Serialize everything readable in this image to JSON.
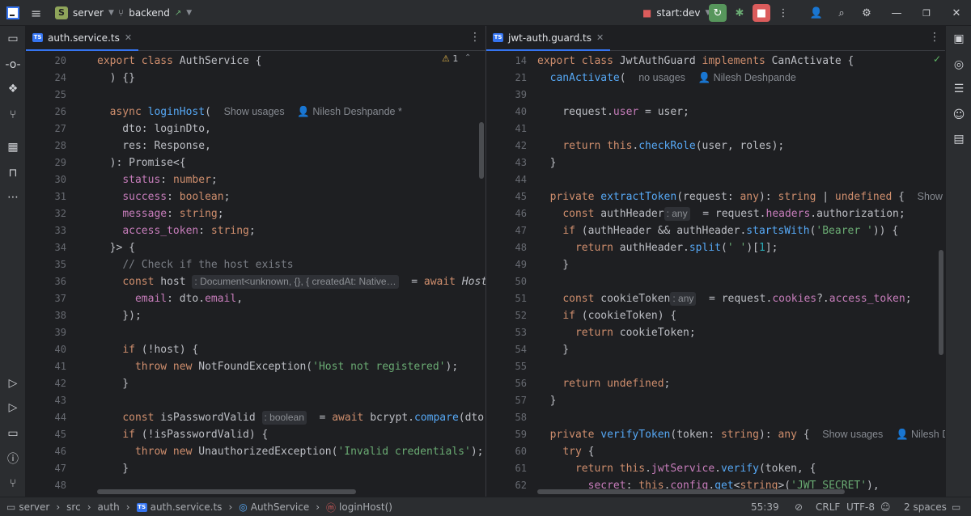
{
  "titlebar": {
    "project_badge": "S",
    "project": "server",
    "branch": "backend",
    "run_config": "start:dev"
  },
  "left_tab": {
    "label": "auth.service.ts",
    "badge": "TS"
  },
  "right_tab": {
    "label": "jwt-auth.guard.ts",
    "badge": "TS"
  },
  "left_editor": {
    "warning_count": "1",
    "line_numbers": [
      "20",
      "24",
      "25",
      "26",
      "27",
      "28",
      "29",
      "30",
      "31",
      "32",
      "33",
      "34",
      "35",
      "36",
      "37",
      "38",
      "39",
      "40",
      "41",
      "42",
      "43",
      "44",
      "45",
      "46",
      "47",
      "48"
    ],
    "hints": {
      "usages": "Show usages",
      "author": "Nilesh Deshpande *",
      "host_type": ": Document<unknown, {}, { createdAt: Native…",
      "bool_type": ": boolean"
    }
  },
  "right_editor": {
    "line_numbers": [
      "14",
      "21",
      "39",
      "40",
      "41",
      "42",
      "43",
      "44",
      "45",
      "46",
      "47",
      "48",
      "49",
      "50",
      "51",
      "52",
      "53",
      "54",
      "55",
      "56",
      "57",
      "58",
      "59",
      "60",
      "61",
      "62"
    ],
    "hints": {
      "no_usages": "no usages",
      "author": "Nilesh Deshpande",
      "usages": "Show usag",
      "usages2": "Show usages",
      "author2": "Nilesh Deshp",
      "any1": ": any",
      "any2": ": any"
    }
  },
  "status": {
    "breadcrumbs": [
      "server",
      "src",
      "auth",
      "auth.service.ts",
      "AuthService",
      "loginHost()"
    ],
    "position": "55:39",
    "line_ending": "CRLF",
    "encoding": "UTF-8",
    "indent": "2 spaces"
  },
  "colors": {
    "accent": "#3574f0",
    "run_green": "#57965c",
    "stop_red": "#db5c5c"
  }
}
